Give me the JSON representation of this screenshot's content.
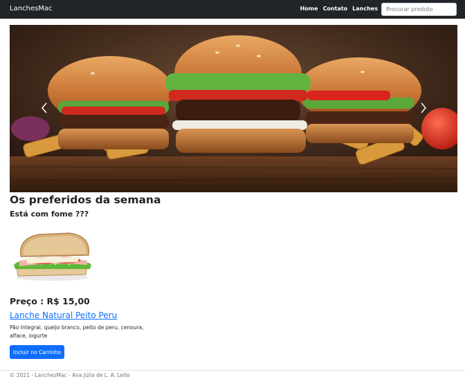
{
  "navbar": {
    "brand": "LanchesMac",
    "links": [
      "Home",
      "Contato",
      "Lanches"
    ],
    "search_placeholder": "Procurar produto"
  },
  "carousel": {
    "image": "burgers-and-fries-photo",
    "prev_icon": "chevron-left-icon",
    "next_icon": "chevron-right-icon"
  },
  "main": {
    "title": "Os preferidos da semana",
    "subtitle": "Está com fome ???"
  },
  "product": {
    "image": "sandwich-photo",
    "price": "Preço : R$ 15,00",
    "name": "Lanche Natural Peito Peru",
    "description": "Pão Integral, queijo branco, peito de peru, cenoura, alface, iogurte",
    "cart_button": "Incluir no Carrinho"
  },
  "footer": {
    "text": "© 2021 - LanchesMac - Ana Júlia de L. A. Leite"
  },
  "colors": {
    "navbar": "#212529",
    "primary": "#0d6efd"
  }
}
